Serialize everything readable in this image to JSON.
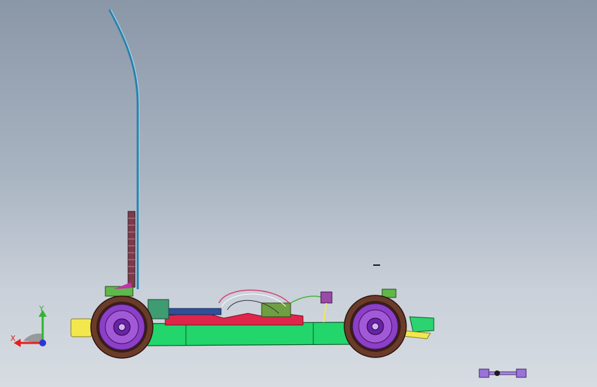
{
  "triad": {
    "y_label": "Y",
    "x_label": "X",
    "y_color": "#2fb52f",
    "x_color": "#e02020",
    "z_color": "#2a36d6"
  },
  "model": {
    "chassis_color": "#22d66c",
    "wheel_color": "#6b3b2a",
    "rim_color": "#8c3fc7",
    "battery_color": "#e0254a",
    "antenna_color": "#2d7fa8",
    "bumper_color": "#f2e84d"
  },
  "icons": {
    "triad": "coordinate-triad-icon",
    "part": "linkage-part-icon"
  }
}
